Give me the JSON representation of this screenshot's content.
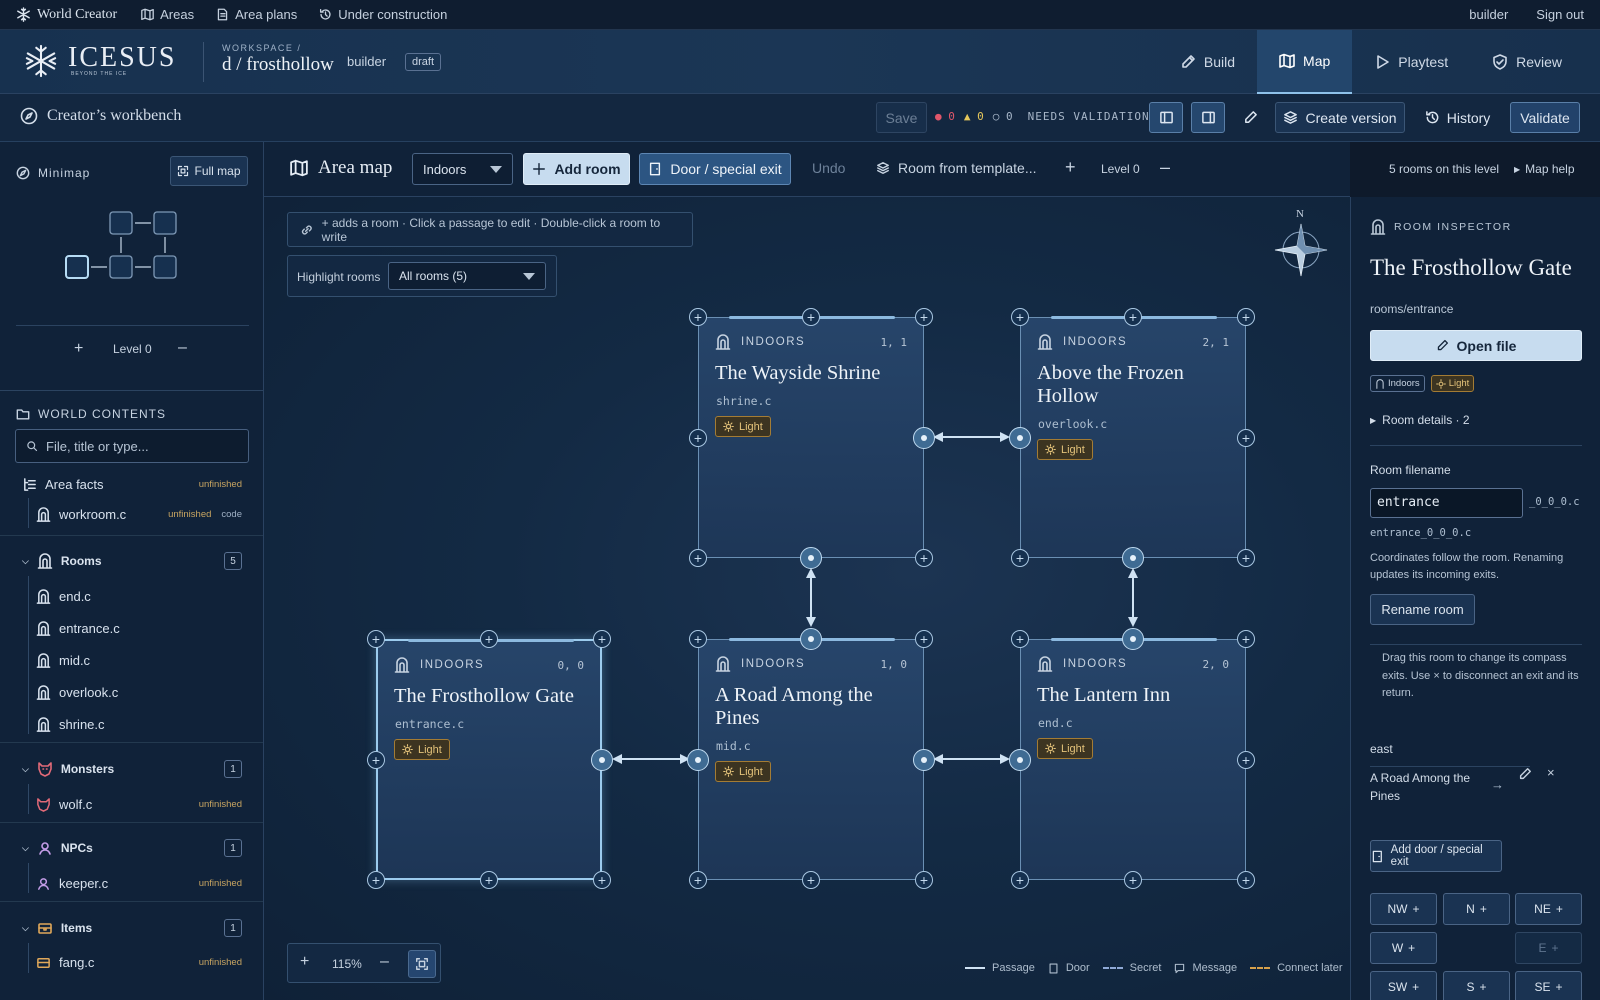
{
  "topbar": {
    "brand": "World Creator",
    "links": [
      "Areas",
      "Area plans",
      "Under construction"
    ],
    "user": "builder",
    "signout": "Sign out"
  },
  "header": {
    "logo": "ICESUS",
    "logo_sub": "BEYOND THE ICE",
    "workspace_label": "WORKSPACE /",
    "workspace_name": "d / frosthollow",
    "owner": "builder",
    "status": "draft",
    "tabs": [
      {
        "label": "Build",
        "icon": "pencil-icon"
      },
      {
        "label": "Map",
        "icon": "map-icon",
        "active": true
      },
      {
        "label": "Playtest",
        "icon": "play-icon"
      },
      {
        "label": "Review",
        "icon": "check-shield-icon"
      }
    ]
  },
  "toolbar": {
    "title": "Creator’s workbench",
    "save": "Save",
    "errors": "0",
    "warnings": "0",
    "infos": "0",
    "validation_status": "NEEDS VALIDATION",
    "create_version": "Create version",
    "history": "History",
    "validate": "Validate"
  },
  "left": {
    "minimap_title": "Minimap",
    "full_map": "Full map",
    "level": "Level 0",
    "contents_title": "WORLD CONTENTS",
    "search_placeholder": "File, title or type...",
    "area_facts": "Area facts",
    "area_facts_tag": "unfinished",
    "workroom": "workroom.c",
    "workroom_tag": "unfinished",
    "workroom_tag2": "code",
    "groups": {
      "rooms": {
        "label": "Rooms",
        "count": "5",
        "items": [
          "end.c",
          "entrance.c",
          "mid.c",
          "overlook.c",
          "shrine.c"
        ]
      },
      "monsters": {
        "label": "Monsters",
        "count": "1",
        "items": [
          "wolf.c"
        ],
        "tag": "unfinished"
      },
      "npcs": {
        "label": "NPCs",
        "count": "1",
        "items": [
          "keeper.c"
        ],
        "tag": "unfinished"
      },
      "items": {
        "label": "Items",
        "count": "1",
        "items": [
          "fang.c"
        ],
        "tag": "unfinished"
      }
    }
  },
  "map": {
    "title": "Area map",
    "filter": "Indoors",
    "add_room": "Add room",
    "door_exit": "Door / special exit",
    "undo": "Undo",
    "from_template": "Room from template...",
    "level": "Level 0",
    "rooms_count": "5 rooms on this level",
    "help": "Map help",
    "hint": "+ adds a room · Click a passage to edit · Double-click a room to write",
    "highlight_label": "Highlight rooms",
    "highlight_value": "All rooms (5)",
    "zoom": "115%",
    "compass_n": "N",
    "legend": [
      "Passage",
      "Door",
      "Secret",
      "Message",
      "Connect later"
    ],
    "rooms": [
      {
        "type": "INDOORS",
        "coords": "1, 1",
        "name": "The Wayside Shrine",
        "file": "shrine.c",
        "light": "Light"
      },
      {
        "type": "INDOORS",
        "coords": "2, 1",
        "name": "Above the Frozen Hollow",
        "file": "overlook.c",
        "light": "Light"
      },
      {
        "type": "INDOORS",
        "coords": "0, 0",
        "name": "The Frosthollow Gate",
        "file": "entrance.c",
        "light": "Light"
      },
      {
        "type": "INDOORS",
        "coords": "1, 0",
        "name": "A Road Among the Pines",
        "file": "mid.c",
        "light": "Light"
      },
      {
        "type": "INDOORS",
        "coords": "2, 0",
        "name": "The Lantern Inn",
        "file": "end.c",
        "light": "Light"
      }
    ]
  },
  "inspector": {
    "label": "ROOM INSPECTOR",
    "name": "The Frosthollow Gate",
    "path": "rooms/entrance",
    "open_file": "Open file",
    "badges": [
      "Indoors",
      "Light"
    ],
    "details": "Room details · 2",
    "filename_label": "Room filename",
    "filename_value": "entrance",
    "filename_suffix": "_0_0_0.c",
    "filename_full": "entrance_0_0_0.c",
    "coords_note": "Coordinates follow the room. Renaming updates its incoming exits.",
    "rename": "Rename room",
    "drag_note": "Drag this room to change its compass exits. Use × to disconnect an exit and its return.",
    "exit_dir": "east",
    "exit_target": "A Road Among the Pines",
    "add_door": "Add door / special exit",
    "dirs": [
      "NW",
      "N",
      "NE",
      "W",
      "E",
      "SW",
      "S",
      "SE"
    ]
  }
}
